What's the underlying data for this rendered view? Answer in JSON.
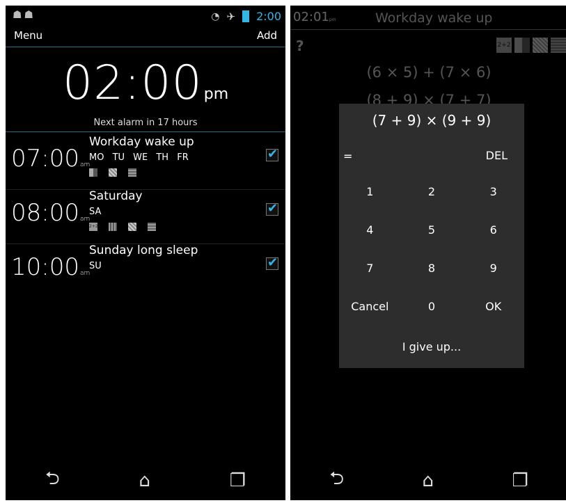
{
  "left": {
    "status_time": "2:00",
    "menu_label": "Menu",
    "add_label": "Add",
    "clock_time": "02:00",
    "clock_ampm": "pm",
    "next_alarm": "Next alarm in 17 hours",
    "alarms": [
      {
        "time": "07:00",
        "ampm": "am",
        "title": "Workday wake up",
        "days": "MO TU WE TH FR",
        "checked": true
      },
      {
        "time": "08:00",
        "ampm": "am",
        "title": "Saturday",
        "days": "SA",
        "checked": true
      },
      {
        "time": "10:00",
        "ampm": "am",
        "title": "Sunday long sleep",
        "days": "SU",
        "checked": true
      }
    ]
  },
  "right": {
    "time": "02:01",
    "ampm": "pm",
    "title": "Workday wake up",
    "question_mark": "?",
    "puzzle_addition_label": "2+2",
    "bg_problem_1": "(6 × 5) + (7 × 6)",
    "bg_problem_2": "(8 + 9) × (7 + 7)",
    "dialog": {
      "question": "(7 + 9) × (9 + 9)",
      "equals": "=",
      "del_label": "DEL",
      "keys": [
        "1",
        "2",
        "3",
        "4",
        "5",
        "6",
        "7",
        "8",
        "9",
        "Cancel",
        "0",
        "OK"
      ],
      "give_up": "I give up..."
    }
  },
  "colors": {
    "accent": "#33b5e5",
    "dialog_bg": "#2d2d2d",
    "screen_bg": "#000000"
  },
  "icons": {
    "status_left": [
      "android-icon",
      "android-icon"
    ],
    "status_right": [
      "wifi-icon",
      "airplane-icon",
      "battery-icon"
    ],
    "nav": [
      "back-icon",
      "home-icon",
      "recents-icon"
    ]
  }
}
